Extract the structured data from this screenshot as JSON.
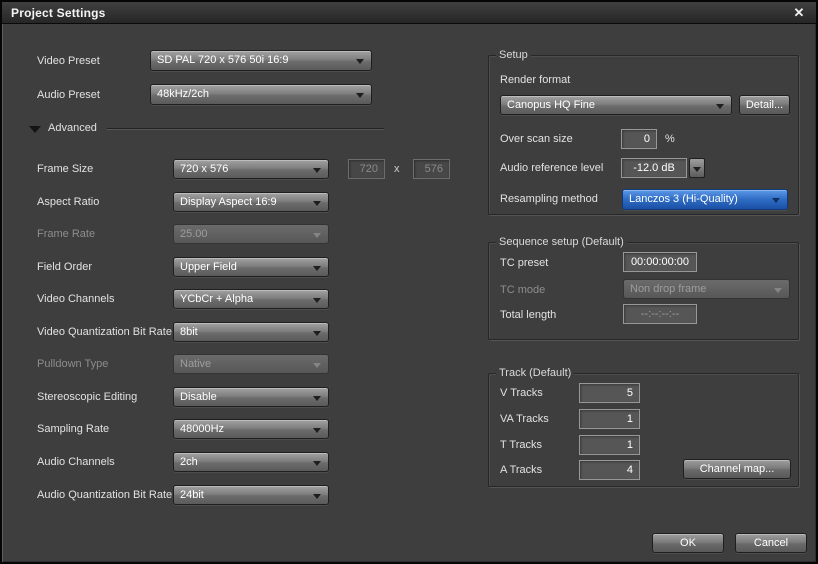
{
  "window": {
    "title": "Project Settings",
    "close_icon": "✕"
  },
  "presets": {
    "video_label": "Video Preset",
    "video_value": "SD PAL 720 x 576 50i 16:9",
    "audio_label": "Audio Preset",
    "audio_value": "48kHz/2ch"
  },
  "advanced": {
    "label": "Advanced",
    "rows": [
      {
        "label": "Frame Size",
        "value": "720 x 576"
      },
      {
        "label": "Aspect Ratio",
        "value": "Display Aspect 16:9"
      },
      {
        "label": "Frame Rate",
        "value": "25.00"
      },
      {
        "label": "Field Order",
        "value": "Upper Field"
      },
      {
        "label": "Video Channels",
        "value": "YCbCr + Alpha"
      },
      {
        "label": "Video Quantization Bit Rate",
        "value": "8bit"
      },
      {
        "label": "Pulldown Type",
        "value": "Native"
      },
      {
        "label": "Stereoscopic Editing",
        "value": "Disable"
      },
      {
        "label": "Sampling Rate",
        "value": "48000Hz"
      },
      {
        "label": "Audio Channels",
        "value": "2ch"
      },
      {
        "label": "Audio Quantization Bit Rate",
        "value": "24bit"
      }
    ],
    "frame_size_fields": {
      "width": "720",
      "separator": "x",
      "height": "576"
    }
  },
  "setup": {
    "title": "Setup",
    "render_format_label": "Render format",
    "render_format_value": "Canopus HQ Fine",
    "detail_button": "Detail...",
    "overscan_label": "Over scan size",
    "overscan_value": "0",
    "overscan_unit": "%",
    "audio_ref_label": "Audio reference level",
    "audio_ref_value": "-12.0 dB",
    "resampling_label": "Resampling method",
    "resampling_value": "Lanczos 3 (Hi-Quality)"
  },
  "sequence": {
    "title": "Sequence setup (Default)",
    "tc_preset_label": "TC preset",
    "tc_preset_value": "00:00:00:00",
    "tc_mode_label": "TC mode",
    "tc_mode_value": "Non drop frame",
    "total_length_label": "Total length",
    "total_length_value": "--:--:--:--"
  },
  "track": {
    "title": "Track (Default)",
    "rows": [
      {
        "label": "V Tracks",
        "value": "5"
      },
      {
        "label": "VA Tracks",
        "value": "1"
      },
      {
        "label": "T Tracks",
        "value": "1"
      },
      {
        "label": "A Tracks",
        "value": "4"
      }
    ],
    "channel_map_button": "Channel map..."
  },
  "footer": {
    "ok_label": "OK",
    "cancel_label": "Cancel"
  },
  "colors": {
    "dialog_bg": "#3e3e3e",
    "titlebar_bg": "#2d2d2d",
    "accent_blue": "#2e6cc4"
  }
}
